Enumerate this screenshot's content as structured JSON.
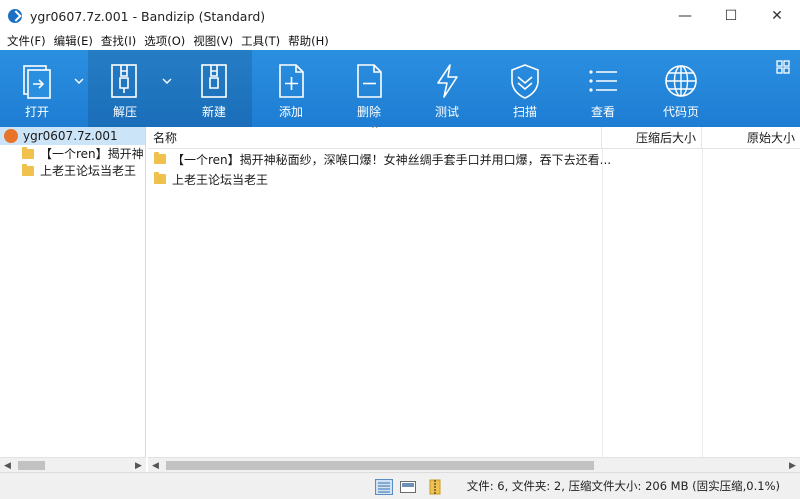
{
  "window": {
    "title": "ygr0607.7z.001 - Bandizip (Standard)",
    "minimize": "—",
    "maximize": "☐",
    "close": "✕"
  },
  "menu": [
    "文件(F)",
    "编辑(E)",
    "查找(I)",
    "选项(O)",
    "视图(V)",
    "工具(T)",
    "帮助(H)"
  ],
  "toolbar": {
    "open": "打开",
    "extract": "解压",
    "new": "新建",
    "add": "添加",
    "delete": "删除",
    "test": "测试",
    "scan": "扫描",
    "view": "查看",
    "codepage": "代码页"
  },
  "tree": {
    "root": "ygr0607.7z.001",
    "items": [
      "【一个ren】揭开神",
      "上老王论坛当老王"
    ]
  },
  "columns": {
    "name": "名称",
    "compressed": "压缩后大小",
    "original": "原始大小"
  },
  "files": [
    "【一个ren】揭开神秘面纱，深喉口爆！女神丝绸手套手口并用口爆，吞下去还看...",
    "上老王论坛当老王"
  ],
  "status": "文件: 6, 文件夹: 2, 压缩文件大小: 206 MB (固实压缩,0.1%)",
  "colors": {
    "toolbar": "#1e7dd3",
    "selection": "#cce4f7",
    "folder": "#f1c14e"
  }
}
